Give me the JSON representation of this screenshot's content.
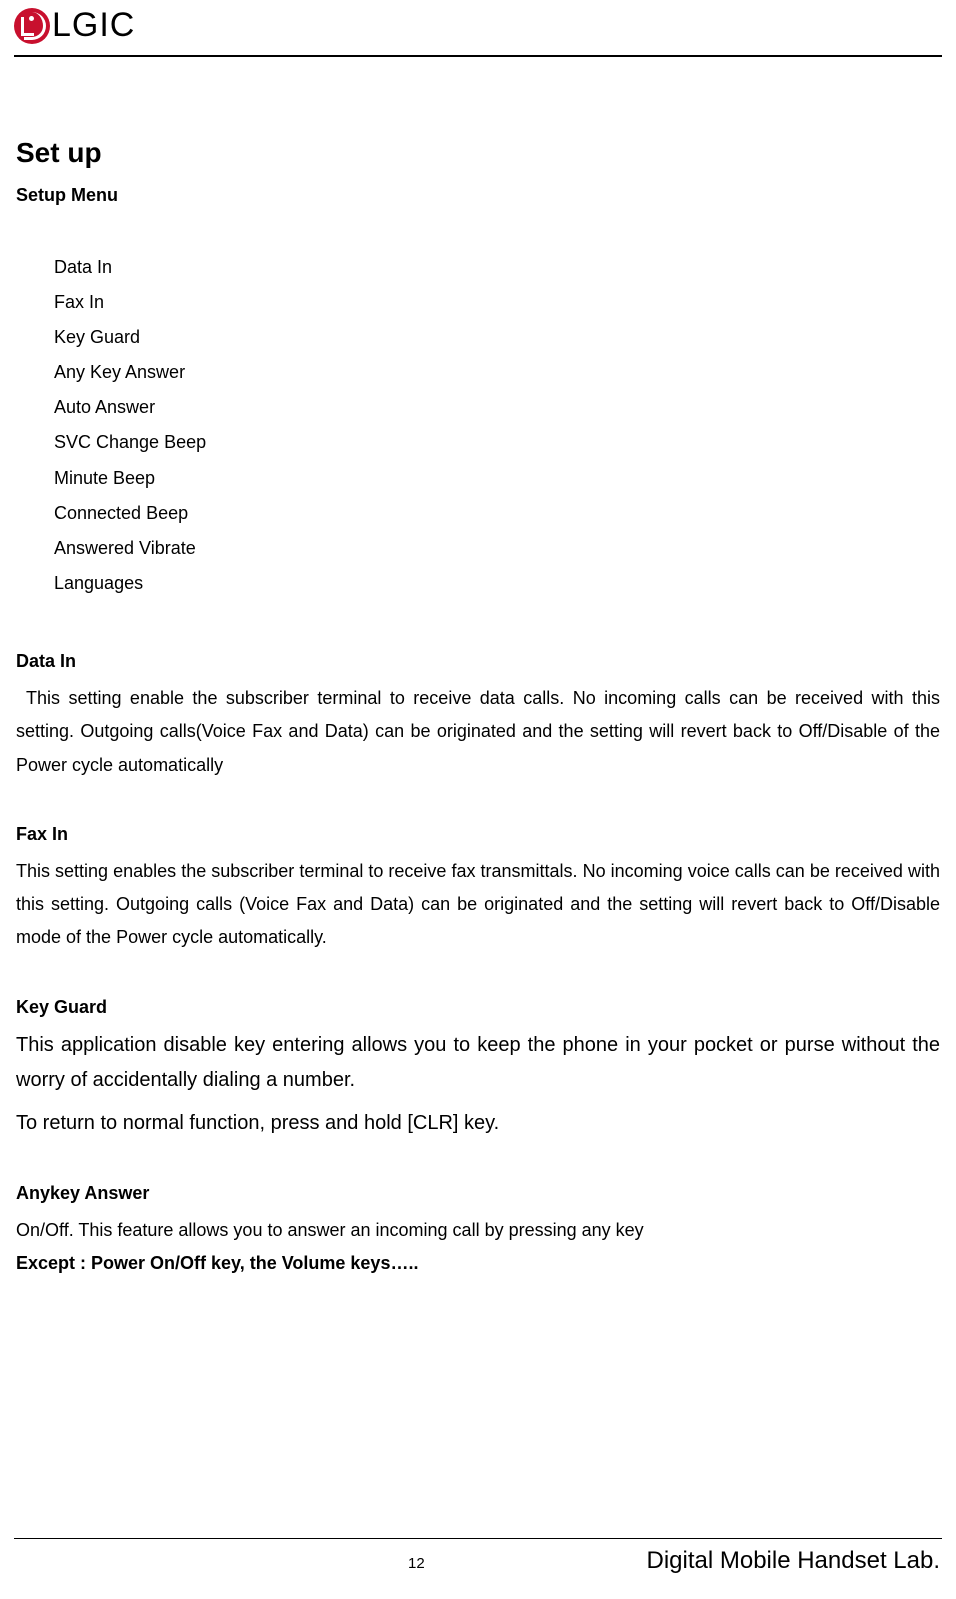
{
  "brand": "LGIC",
  "title": "Set up",
  "subtitle": "Setup Menu",
  "menu_items": [
    "Data In",
    "Fax In",
    "Key Guard",
    "Any Key Answer",
    "Auto Answer",
    "SVC Change Beep",
    "Minute Beep",
    "Connected Beep",
    "Answered Vibrate",
    "Languages"
  ],
  "sections": {
    "data_in": {
      "heading": "Data In",
      "body": "This setting enable the subscriber terminal to receive data calls. No incoming calls can be received with this setting. Outgoing calls(Voice Fax and Data) can be originated and the setting will revert back to Off/Disable of the Power cycle automatically"
    },
    "fax_in": {
      "heading": "Fax In",
      "body": "This setting enables the subscriber terminal to receive fax transmittals. No incoming voice calls can be received with this setting. Outgoing calls (Voice Fax and Data) can be originated and the setting will revert back to Off/Disable mode of the Power cycle automatically."
    },
    "key_guard": {
      "heading": "Key Guard",
      "body1": "This application disable key entering allows you to keep the phone in your pocket or purse without the worry of accidentally dialing a number.",
      "body2": "To return to normal function, press and hold [CLR] key."
    },
    "anykey": {
      "heading": "Anykey Answer",
      "body": "On/Off. This feature allows you to answer an incoming call by pressing any key",
      "except": "Except : Power On/Off key, the Volume keys….."
    }
  },
  "footer": {
    "page": "12",
    "lab": "Digital Mobile Handset Lab."
  }
}
